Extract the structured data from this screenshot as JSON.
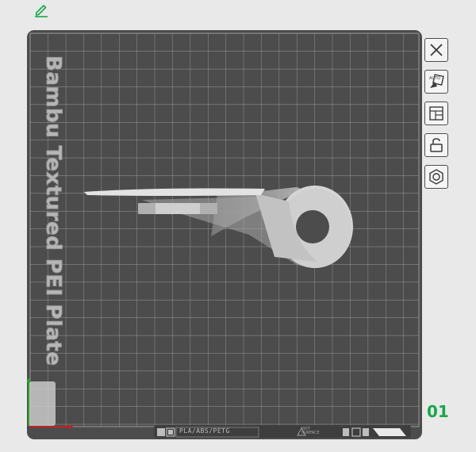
{
  "plate": {
    "label": "Bambu Textured PEI Plate",
    "number": "01",
    "filament_types": "PLA/ABS/PETG",
    "hot_surface_line1": "HOT",
    "hot_surface_line2": "SURFACE"
  },
  "toolbar": {
    "items": [
      {
        "name": "close",
        "icon": "x-icon"
      },
      {
        "name": "auto-orient",
        "icon": "auto-orient-icon"
      },
      {
        "name": "arrange",
        "icon": "arrange-icon"
      },
      {
        "name": "lock",
        "icon": "unlock-icon"
      },
      {
        "name": "settings",
        "icon": "hex-nut-icon"
      }
    ]
  },
  "colors": {
    "background": "#e8e9e8",
    "plate": "#4c4c4c",
    "grid": "#9e9e9e",
    "model": "#d7d7d7",
    "accent_green": "#1aa64c"
  }
}
